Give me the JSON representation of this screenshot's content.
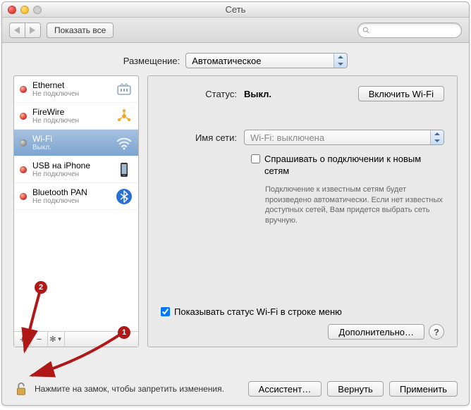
{
  "window": {
    "title": "Сеть"
  },
  "toolbar": {
    "back_icon": "triangle-left-icon",
    "forward_icon": "triangle-right-icon",
    "show_all": "Показать все",
    "search_placeholder": ""
  },
  "location": {
    "label": "Размещение:",
    "value": "Автоматическое"
  },
  "services": [
    {
      "name": "Ethernet",
      "status": "Не подключен",
      "dot": "red",
      "icon": "ethernet"
    },
    {
      "name": "FireWire",
      "status": "Не подключен",
      "dot": "red",
      "icon": "firewire"
    },
    {
      "name": "Wi-Fi",
      "status": "Выкл.",
      "dot": "off",
      "icon": "wifi",
      "selected": true
    },
    {
      "name": "USB на iPhone",
      "status": "Не подключен",
      "dot": "red",
      "icon": "iphone"
    },
    {
      "name": "Bluetooth PAN",
      "status": "Не подключен",
      "dot": "red",
      "icon": "bluetooth"
    }
  ],
  "sidebar_footer": {
    "add": "+",
    "remove": "−",
    "gear": "✻▾"
  },
  "detail": {
    "status_label": "Статус:",
    "status_value": "Выкл.",
    "toggle_btn": "Включить Wi-Fi",
    "network_label": "Имя сети:",
    "network_value": "Wi-Fi: выключена",
    "ask_checkbox": "Спрашивать о подключении к новым сетям",
    "ask_help": "Подключение к известным сетям будет произведено автоматически. Если нет известных доступных сетей, Вам придется выбрать сеть вручную.",
    "menubar_checkbox": "Показывать статус Wi-Fi в строке меню",
    "advanced_btn": "Дополнительно…"
  },
  "bottom": {
    "lock_text": "Нажмите на замок, чтобы запретить изменения.",
    "assistant_btn": "Ассистент…",
    "revert_btn": "Вернуть",
    "apply_btn": "Применить"
  },
  "annotations": {
    "badge1": "1",
    "badge2": "2"
  }
}
